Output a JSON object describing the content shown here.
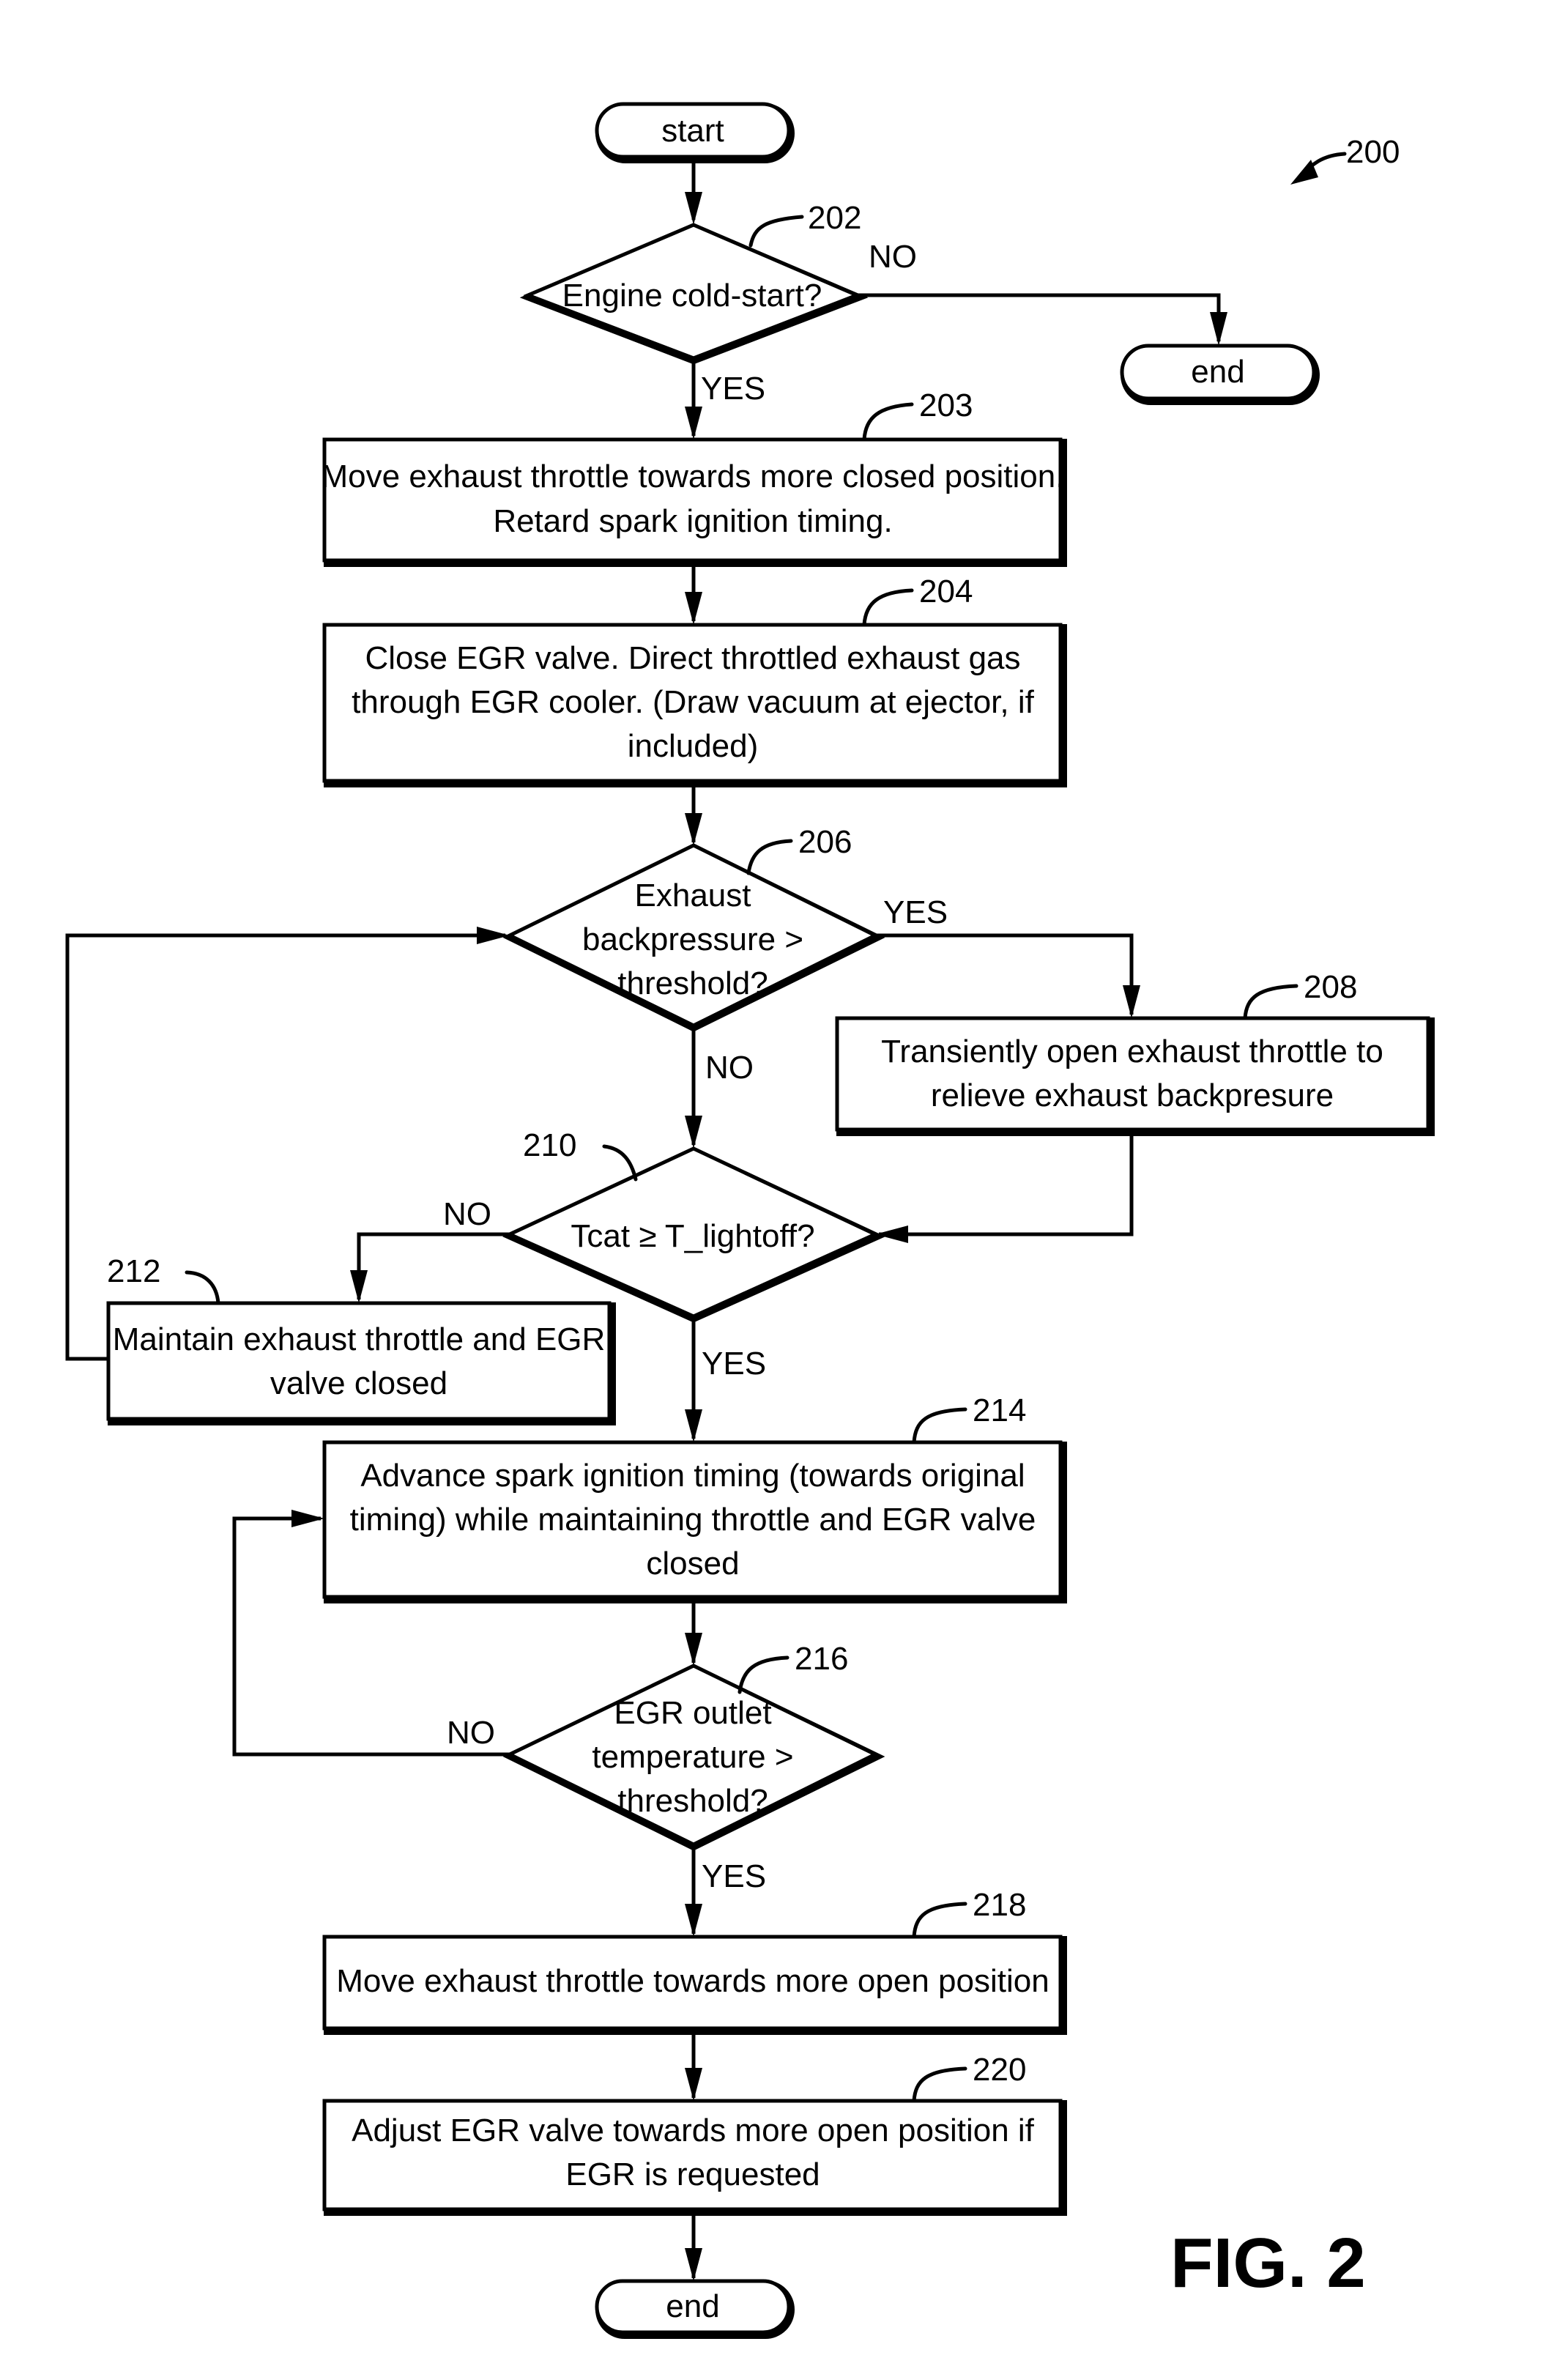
{
  "figure": {
    "label": "FIG. 2",
    "reference": "200"
  },
  "nodes": {
    "start": {
      "text": "start"
    },
    "n202": {
      "ref": "202",
      "lines": [
        "Engine cold-start?"
      ]
    },
    "end_top": {
      "text": "end"
    },
    "n203": {
      "ref": "203",
      "lines": [
        "Move exhaust throttle towards more closed position.",
        "Retard spark ignition timing."
      ]
    },
    "n204": {
      "ref": "204",
      "lines": [
        "Close EGR valve. Direct throttled exhaust gas",
        "through EGR cooler. (Draw vacuum at ejector, if",
        "included)"
      ]
    },
    "n206": {
      "ref": "206",
      "lines": [
        "Exhaust",
        "backpressure >",
        "threshold?"
      ]
    },
    "n208": {
      "ref": "208",
      "lines": [
        "Transiently open exhaust throttle to",
        "relieve exhaust backpresure"
      ]
    },
    "n210": {
      "ref": "210",
      "lines": [
        "Tcat ≥ T_lightoff?"
      ]
    },
    "n212": {
      "ref": "212",
      "lines": [
        "Maintain exhaust throttle and EGR",
        "valve closed"
      ]
    },
    "n214": {
      "ref": "214",
      "lines": [
        "Advance spark ignition timing (towards original",
        "timing) while maintaining throttle and EGR valve",
        "closed"
      ]
    },
    "n216": {
      "ref": "216",
      "lines": [
        "EGR outlet",
        "temperature >",
        "threshold?"
      ]
    },
    "n218": {
      "ref": "218",
      "lines": [
        "Move exhaust throttle towards more open position"
      ]
    },
    "n220": {
      "ref": "220",
      "lines": [
        "Adjust EGR valve towards more open position if",
        "EGR is requested"
      ]
    },
    "end_bottom": {
      "text": "end"
    }
  },
  "edge_labels": {
    "n202_no": "NO",
    "n202_yes": "YES",
    "n206_yes": "YES",
    "n206_no": "NO",
    "n210_no": "NO",
    "n210_yes": "YES",
    "n216_no": "NO",
    "n216_yes": "YES"
  }
}
